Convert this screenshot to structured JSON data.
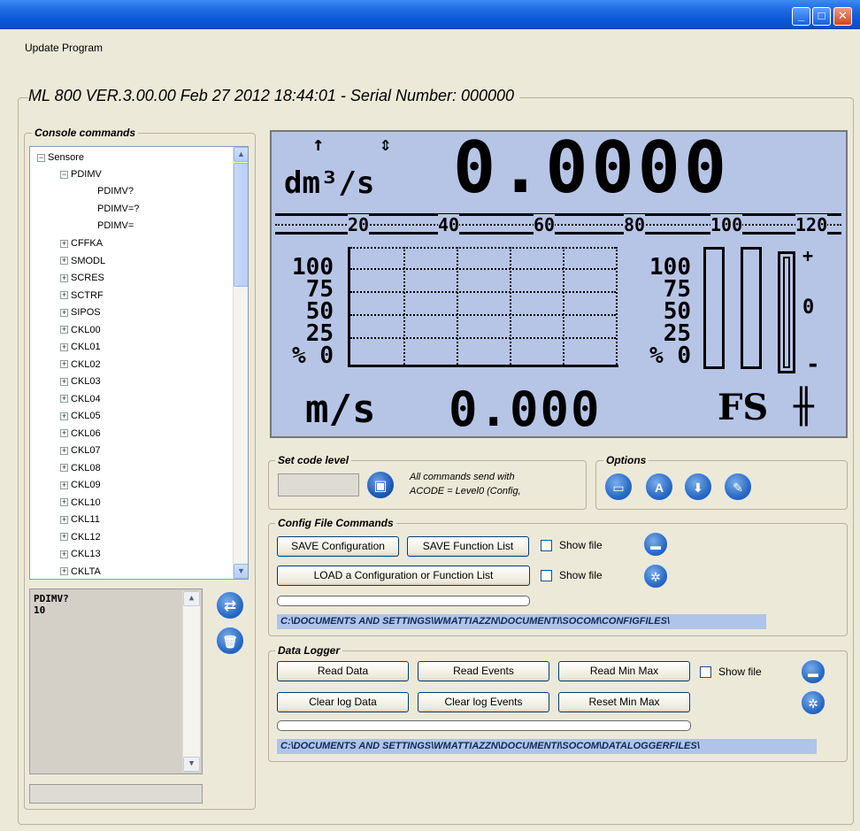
{
  "window": {
    "minimize_label": "_",
    "maximize_label": "□",
    "close_label": "✕"
  },
  "menu": {
    "update_program": "Update Program"
  },
  "header": {
    "title": "ML 800 VER.3.00.00  Feb 27 2012 18:44:01  -  Serial Number: 000000"
  },
  "console": {
    "legend": "Console commands",
    "tree": {
      "root": "Sensore",
      "expanded": "PDIMV",
      "children": [
        "PDIMV?",
        "PDIMV=?",
        "PDIMV="
      ],
      "items": [
        "CFFKA",
        "SMODL",
        "SCRES",
        "SCTRF",
        "SIPOS",
        "CKL00",
        "CKL01",
        "CKL02",
        "CKL03",
        "CKL04",
        "CKL05",
        "CKL06",
        "CKL07",
        "CKL08",
        "CKL09",
        "CKL10",
        "CKL11",
        "CKL12",
        "CKL13",
        "CKLTA"
      ]
    },
    "output_line1": "PDIMV?",
    "output_line2": "10",
    "refresh_icon": "refresh-icon",
    "trash_icon": "trash-icon"
  },
  "lcd": {
    "unit_top": "dm³/s",
    "value_top": "0.0000",
    "scale": [
      "20",
      "40",
      "60",
      "80",
      "100",
      "120"
    ],
    "left_axis": [
      "100",
      "75",
      "50",
      "25",
      "% 0"
    ],
    "right_axis": [
      "100",
      "75",
      "50",
      "25",
      "% 0"
    ],
    "plus_sign": "+",
    "zero_mark": "0",
    "minus_sign": "-",
    "unit_bottom": "m/s",
    "value_bottom": "0.000",
    "fs_label": "FS",
    "bar_levels": [
      0,
      0,
      0
    ]
  },
  "set_code": {
    "legend": "Set code level",
    "input_value": "",
    "note_line1": "All commands send with",
    "note_line2": "ACODE = Level0  (Config,",
    "lock_icon": "lock-icon"
  },
  "options": {
    "legend": "Options",
    "icons": [
      "tv-icon",
      "font-icon",
      "download-icon",
      "wrench-icon"
    ]
  },
  "config": {
    "legend": "Config File Commands",
    "save_config": "SAVE Configuration",
    "save_function": "SAVE Function List",
    "show_file_1": "Show file",
    "load": "LOAD a Configuration or Function List",
    "show_file_2": "Show file",
    "progress": 0,
    "path": "C:\\DOCUMENTS AND SETTINGS\\WMATTIAZZN\\DOCUMENTI\\SOCOM\\CONFIGFILES\\"
  },
  "logger": {
    "legend": "Data Logger",
    "read_data": "Read Data",
    "read_events": "Read Events",
    "read_minmax": "Read Min Max",
    "show_file": "Show file",
    "clear_data": "Clear log Data",
    "clear_events": "Clear log Events",
    "reset_minmax": "Reset Min Max",
    "progress": 0,
    "path": "C:\\DOCUMENTS AND SETTINGS\\WMATTIAZZN\\DOCUMENTI\\SOCOM\\DATALOGGERFILES\\"
  }
}
